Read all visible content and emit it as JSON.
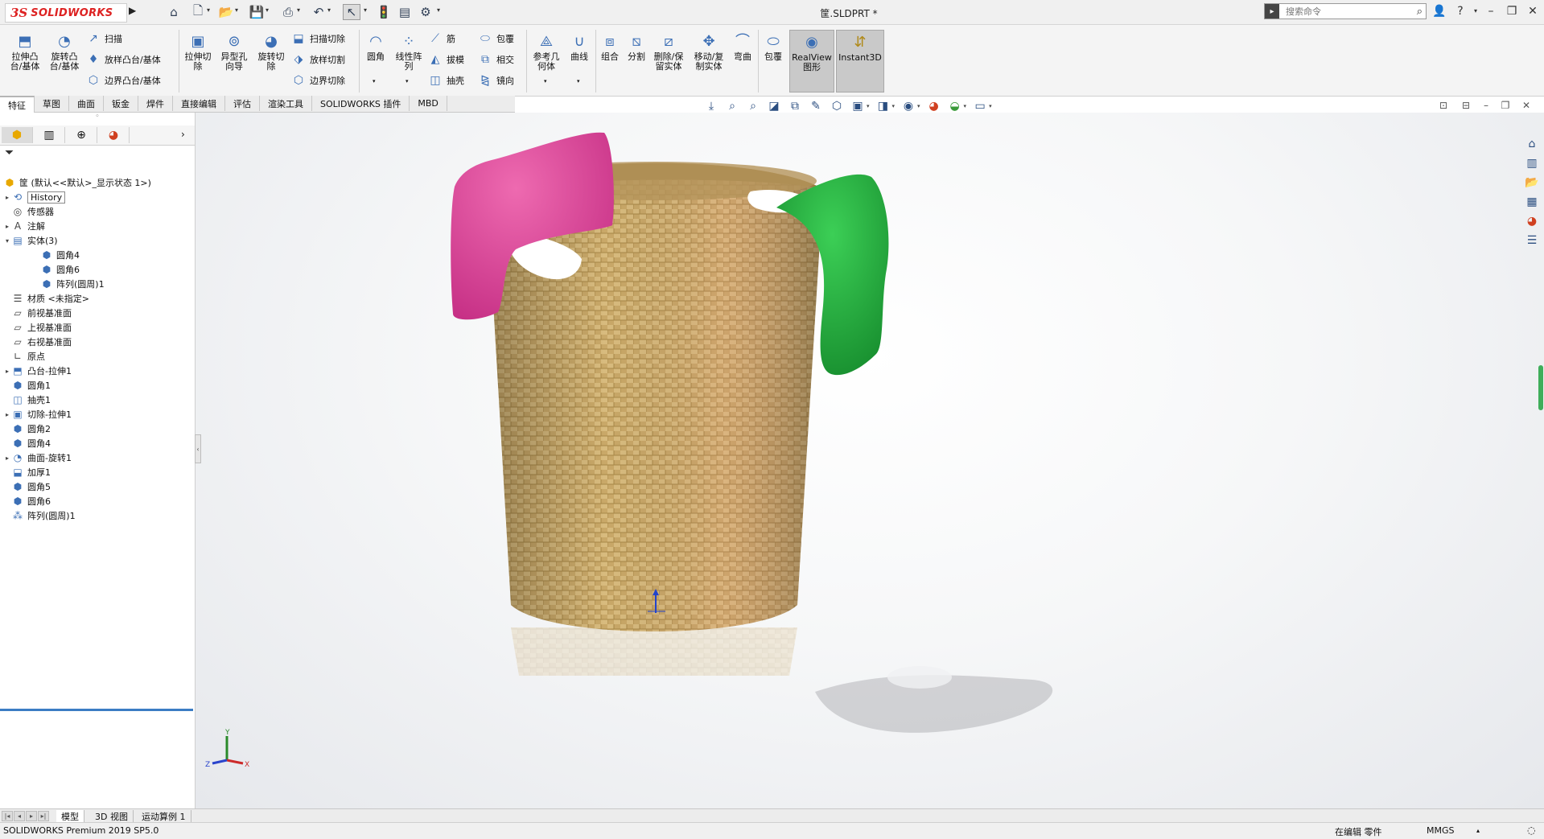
{
  "app": {
    "logo_mark": "3S",
    "logo_text": "SOLIDWORKS",
    "doc_title": "筐.SLDPRT *"
  },
  "search": {
    "placeholder": "搜索命令"
  },
  "ribbon": {
    "extrude_boss": "拉伸凸\n台/基体",
    "revolve_boss": "旋转凸\n台/基体",
    "sweep": "扫描",
    "loft_boss": "放样凸台/基体",
    "boundary_boss": "边界凸台/基体",
    "extrude_cut": "拉伸切\n除",
    "hole_wizard": "异型孔\n向导",
    "revolve_cut": "旋转切\n除",
    "sweep_cut": "扫描切除",
    "loft_cut": "放样切割",
    "boundary_cut": "边界切除",
    "fillet": "圆角",
    "linear_pattern": "线性阵\n列",
    "rib": "筋",
    "draft": "拔模",
    "shell": "抽壳",
    "wrap": "包覆",
    "intersect": "相交",
    "mirror": "镜向",
    "ref_geometry": "参考几\n何体",
    "curves": "曲线",
    "combine": "组合",
    "split": "分割",
    "delete_keep_body": "删除/保\n留实体",
    "move_copy_body": "移动/复\n制实体",
    "flex": "弯曲",
    "wrap2": "包覆",
    "realview": "RealView\n图形",
    "instant3d": "Instant3D"
  },
  "tabs": [
    "特征",
    "草图",
    "曲面",
    "钣金",
    "焊件",
    "直接编辑",
    "评估",
    "渲染工具",
    "SOLIDWORKS 插件",
    "MBD"
  ],
  "tree": {
    "root": "筐 (默认<<默认>_显示状态 1>)",
    "items": [
      {
        "label": "History",
        "icon": "history-icon",
        "expand": "▸",
        "indent": 0
      },
      {
        "label": "传感器",
        "icon": "sensor-icon",
        "expand": "",
        "indent": 0
      },
      {
        "label": "注解",
        "icon": "annotation-icon",
        "expand": "▸",
        "indent": 0
      },
      {
        "label": "实体(3)",
        "icon": "solid-bodies-folder-icon",
        "expand": "▾",
        "indent": 0
      },
      {
        "label": "圆角4",
        "icon": "solid-body-icon",
        "expand": "",
        "indent": 1
      },
      {
        "label": "圆角6",
        "icon": "solid-body-icon",
        "expand": "",
        "indent": 1
      },
      {
        "label": "阵列(圆周)1",
        "icon": "solid-body-icon",
        "expand": "",
        "indent": 1
      },
      {
        "label": "材质 <未指定>",
        "icon": "material-icon",
        "expand": "",
        "indent": 0
      },
      {
        "label": "前视基准面",
        "icon": "plane-icon",
        "expand": "",
        "indent": 0
      },
      {
        "label": "上视基准面",
        "icon": "plane-icon",
        "expand": "",
        "indent": 0
      },
      {
        "label": "右视基准面",
        "icon": "plane-icon",
        "expand": "",
        "indent": 0
      },
      {
        "label": "原点",
        "icon": "origin-icon",
        "expand": "",
        "indent": 0
      },
      {
        "label": "凸台-拉伸1",
        "icon": "extrude-feature-icon",
        "expand": "▸",
        "indent": 0
      },
      {
        "label": "圆角1",
        "icon": "fillet-feature-icon",
        "expand": "",
        "indent": 0
      },
      {
        "label": "抽壳1",
        "icon": "shell-feature-icon",
        "expand": "",
        "indent": 0
      },
      {
        "label": "切除-拉伸1",
        "icon": "cut-feature-icon",
        "expand": "▸",
        "indent": 0
      },
      {
        "label": "圆角2",
        "icon": "fillet-feature-icon",
        "expand": "",
        "indent": 0
      },
      {
        "label": "圆角4",
        "icon": "fillet-feature-icon",
        "expand": "",
        "indent": 0
      },
      {
        "label": "曲面-旋转1",
        "icon": "revolve-surface-icon",
        "expand": "▸",
        "indent": 0
      },
      {
        "label": "加厚1",
        "icon": "thicken-feature-icon",
        "expand": "",
        "indent": 0
      },
      {
        "label": "圆角5",
        "icon": "fillet-feature-icon",
        "expand": "",
        "indent": 0
      },
      {
        "label": "圆角6",
        "icon": "fillet-feature-icon",
        "expand": "",
        "indent": 0
      },
      {
        "label": "阵列(圆周)1",
        "icon": "circular-pattern-icon",
        "expand": "",
        "indent": 0
      }
    ]
  },
  "triad": {
    "x": "X",
    "y": "Y",
    "z": "Z"
  },
  "bottom_tabs": [
    "模型",
    "3D 视图",
    "运动算例 1"
  ],
  "status": {
    "product": "SOLIDWORKS Premium 2019 SP5.0",
    "editing": "在编辑 零件",
    "units": "MMGS"
  },
  "colors": {
    "towel_pink": "#e0449a",
    "towel_green": "#1fa23a",
    "wicker": "#c9a868",
    "accent": "#3c6fb5"
  }
}
